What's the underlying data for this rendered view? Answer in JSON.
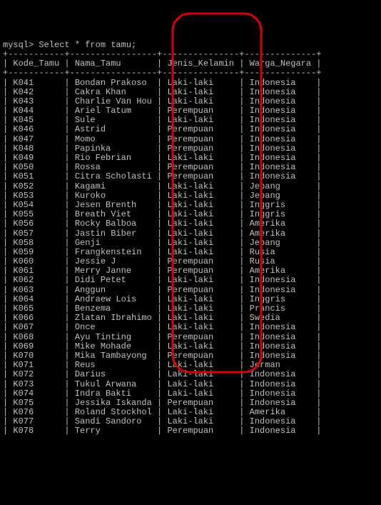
{
  "prompt": "mysql> Select * from tamu;",
  "sep_line": "+-----------+-----------------+---------------+--------------+",
  "header": {
    "c1": "Kode_Tamu",
    "c2": "Nama_Tamu",
    "c3": "Jenis_Kelamin",
    "c4": "Warga_Negara"
  },
  "rows": [
    {
      "c1": "K041",
      "c2": "Bondan Prakoso",
      "c3": "Laki-laki",
      "c4": "Indonesia"
    },
    {
      "c1": "K042",
      "c2": "Cakra Khan",
      "c3": "Laki-laki",
      "c4": "Indonesia"
    },
    {
      "c1": "K043",
      "c2": "Charlie Van Hou",
      "c3": "Laki-laki",
      "c4": "Indonesia"
    },
    {
      "c1": "K044",
      "c2": "Ariel Tatum",
      "c3": "Perempuan",
      "c4": "Indonesia"
    },
    {
      "c1": "K045",
      "c2": "Sule",
      "c3": "Laki-laki",
      "c4": "Indonesia"
    },
    {
      "c1": "K046",
      "c2": "Astrid",
      "c3": "Perempuan",
      "c4": "Indonesia"
    },
    {
      "c1": "K047",
      "c2": "Momo",
      "c3": "Perempuan",
      "c4": "Indonesia"
    },
    {
      "c1": "K048",
      "c2": "Papinka",
      "c3": "Perempuan",
      "c4": "Indonesia"
    },
    {
      "c1": "K049",
      "c2": "Rio Febrian",
      "c3": "Laki-laki",
      "c4": "Indonesia"
    },
    {
      "c1": "K050",
      "c2": "Rossa",
      "c3": "Perempuan",
      "c4": "Indonesia"
    },
    {
      "c1": "K051",
      "c2": "Citra Scholasti",
      "c3": "Perempuan",
      "c4": "Indonesia"
    },
    {
      "c1": "K052",
      "c2": "Kagami",
      "c3": "Laki-laki",
      "c4": "Jepang"
    },
    {
      "c1": "K053",
      "c2": "Kuroko",
      "c3": "Laki-laki",
      "c4": "Jepang"
    },
    {
      "c1": "K054",
      "c2": "Jesen Brenth",
      "c3": "Laki-laki",
      "c4": "Inggris"
    },
    {
      "c1": "K055",
      "c2": "Breath Viet",
      "c3": "Laki-laki",
      "c4": "Inggris"
    },
    {
      "c1": "K056",
      "c2": "Rocky Balboa",
      "c3": "Laki-laki",
      "c4": "Amerika"
    },
    {
      "c1": "K057",
      "c2": "Jastin Biber",
      "c3": "Laki-laki",
      "c4": "Amerika"
    },
    {
      "c1": "K058",
      "c2": "Genji",
      "c3": "Laki-laki",
      "c4": "Jepang"
    },
    {
      "c1": "K059",
      "c2": "Frangkenstein",
      "c3": "Laki-laki",
      "c4": "Rusia"
    },
    {
      "c1": "K060",
      "c2": "Jessie J",
      "c3": "Perempuan",
      "c4": "Rusia"
    },
    {
      "c1": "K061",
      "c2": "Merry Janne",
      "c3": "Perempuan",
      "c4": "Amerika"
    },
    {
      "c1": "K062",
      "c2": "Didi Petet",
      "c3": "Laki-laki",
      "c4": "Indonesia"
    },
    {
      "c1": "K063",
      "c2": "Anggun",
      "c3": "Perempuan",
      "c4": "Indonesia"
    },
    {
      "c1": "K064",
      "c2": "Andraew Lois",
      "c3": "Laki-laki",
      "c4": "Inggris"
    },
    {
      "c1": "K065",
      "c2": "Benzema",
      "c3": "Laki-laki",
      "c4": "Prancis"
    },
    {
      "c1": "K066",
      "c2": "Zlatan Ibrahimo",
      "c3": "Laki-laki",
      "c4": "Swedia"
    },
    {
      "c1": "K067",
      "c2": "Once",
      "c3": "Laki-laki",
      "c4": "Indonesia"
    },
    {
      "c1": "K068",
      "c2": "Ayu Tinting",
      "c3": "Perempuan",
      "c4": "Indonesia"
    },
    {
      "c1": "K069",
      "c2": "Mike Mohade",
      "c3": "Laki-laki",
      "c4": "Indonesia"
    },
    {
      "c1": "K070",
      "c2": "Mika Tambayong",
      "c3": "Perempuan",
      "c4": "Indonesia"
    },
    {
      "c1": "K071",
      "c2": "Reus",
      "c3": "Laki-laki",
      "c4": "Jerman"
    },
    {
      "c1": "K072",
      "c2": "Darius",
      "c3": "Laki-laki",
      "c4": "Indonesia"
    },
    {
      "c1": "K073",
      "c2": "Tukul Arwana",
      "c3": "Laki-laki",
      "c4": "Indonesia"
    },
    {
      "c1": "K074",
      "c2": "Indra Bakti",
      "c3": "Laki-laki",
      "c4": "Indonesia"
    },
    {
      "c1": "K075",
      "c2": "Jessika Iskanda",
      "c3": "Perempuan",
      "c4": "Indonesia"
    },
    {
      "c1": "K076",
      "c2": "Roland Stockhol",
      "c3": "Laki-laki",
      "c4": "Amerika"
    },
    {
      "c1": "K077",
      "c2": "Sandi Sandoro",
      "c3": "Laki-laki",
      "c4": "Indonesia"
    },
    {
      "c1": "K078",
      "c2": "Terry",
      "c3": "Perempuan",
      "c4": "Indonesia"
    }
  ],
  "highlight": {
    "column": "Jenis_Kelamin",
    "color": "#d80000"
  }
}
